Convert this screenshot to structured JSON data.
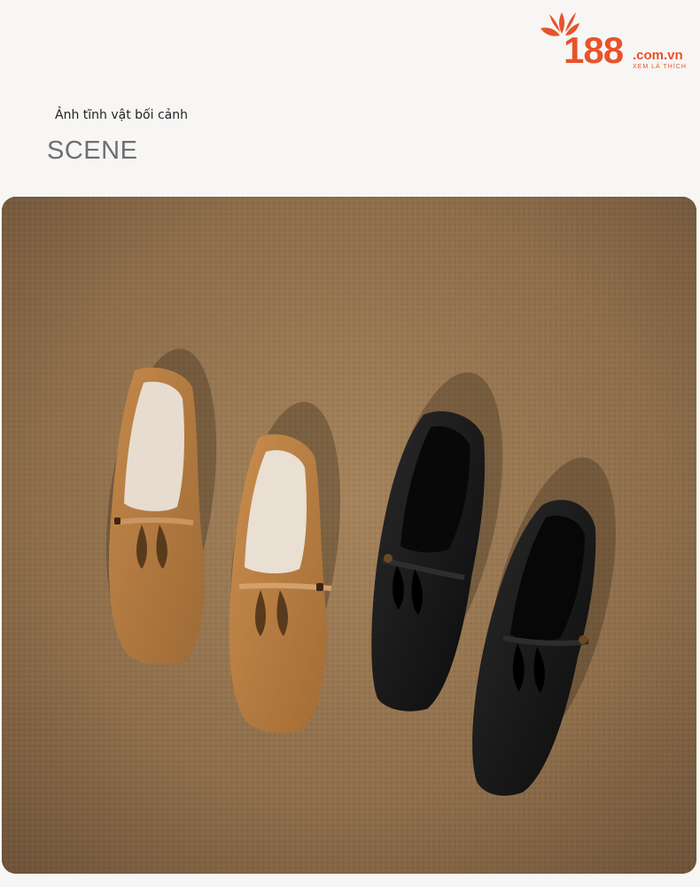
{
  "brand": {
    "number": "188",
    "domain": ".com.vn",
    "slogan": "XEM LÀ THÍCH",
    "color": "#e8532a"
  },
  "section": {
    "subtitle": "Ảnh tĩnh vật bối cảnh",
    "title": "SCENE"
  },
  "photo": {
    "description_icon": "product-photo",
    "background_color": "#8c6d4b",
    "items": [
      {
        "name": "tan-left-shoe",
        "color": "#b27a43"
      },
      {
        "name": "tan-right-shoe",
        "color": "#b8803f"
      },
      {
        "name": "black-left-shoe",
        "color": "#161616"
      },
      {
        "name": "black-right-shoe",
        "color": "#141414"
      }
    ]
  }
}
